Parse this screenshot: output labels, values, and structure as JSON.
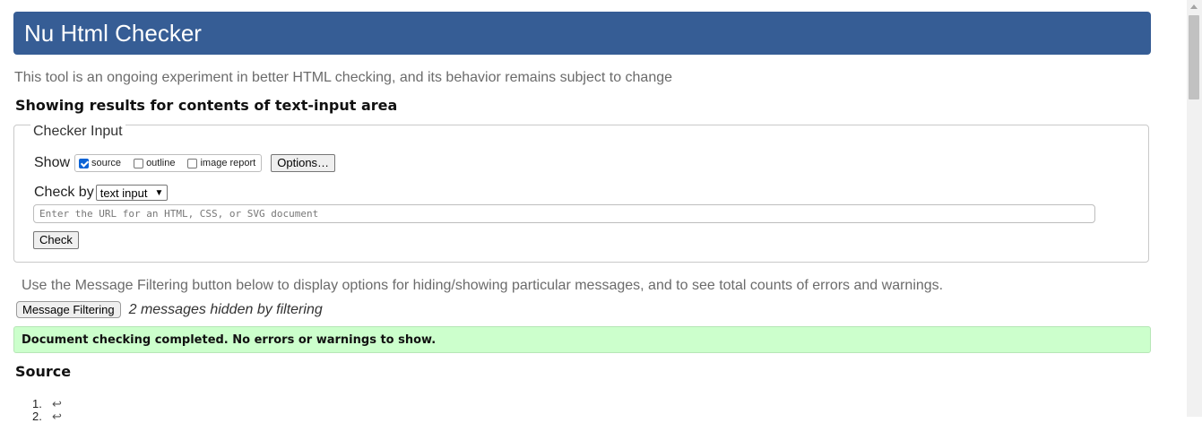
{
  "header": {
    "title": "Nu Html Checker"
  },
  "intro": "This tool is an ongoing experiment in better HTML checking, and its behavior remains subject to change",
  "results_heading": "Showing results for contents of text-input area",
  "checker_input": {
    "legend": "Checker Input",
    "show_label": "Show",
    "show_options": [
      {
        "label": "source",
        "checked": true
      },
      {
        "label": "outline",
        "checked": false
      },
      {
        "label": "image report",
        "checked": false
      }
    ],
    "options_button": "Options…",
    "check_by_label": "Check by",
    "check_by_value": "text input",
    "url_placeholder": "Enter the URL for an HTML, CSS, or SVG document",
    "check_button": "Check"
  },
  "filtering": {
    "text": "Use the Message Filtering button below to display options for hiding/showing particular messages, and to see total counts of errors and warnings.",
    "button": "Message Filtering",
    "hidden_note": "2 messages hidden by filtering"
  },
  "status": {
    "message": "Document checking completed. No errors or warnings to show.",
    "color": "#ccffcc"
  },
  "source": {
    "heading": "Source",
    "lines": [
      {
        "num": "1.",
        "content": "↩"
      },
      {
        "num": "2.",
        "content": "↩"
      }
    ]
  },
  "colors": {
    "header_bg": "#365d95"
  }
}
